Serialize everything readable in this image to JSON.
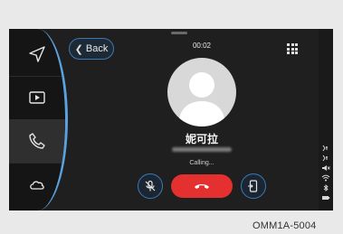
{
  "call_screen": {
    "timer": "00:02",
    "contact_name": "妮可拉",
    "status": "Calling..."
  },
  "nav": {
    "back_label": "Back",
    "items": [
      {
        "icon": "navigation-icon",
        "active": false
      },
      {
        "icon": "media-icon",
        "active": false
      },
      {
        "icon": "phone-icon",
        "active": true
      },
      {
        "icon": "cloud-icon",
        "active": false
      }
    ]
  },
  "status_icons": [
    "signal-icon",
    "signal-icon",
    "volume-mute-icon",
    "wifi-icon",
    "bluetooth-icon",
    "battery-icon"
  ],
  "colors": {
    "accent": "#5aa1de",
    "end_call": "#e4302e",
    "background": "#1f1f1f"
  },
  "caption": "OMM1A-5004"
}
